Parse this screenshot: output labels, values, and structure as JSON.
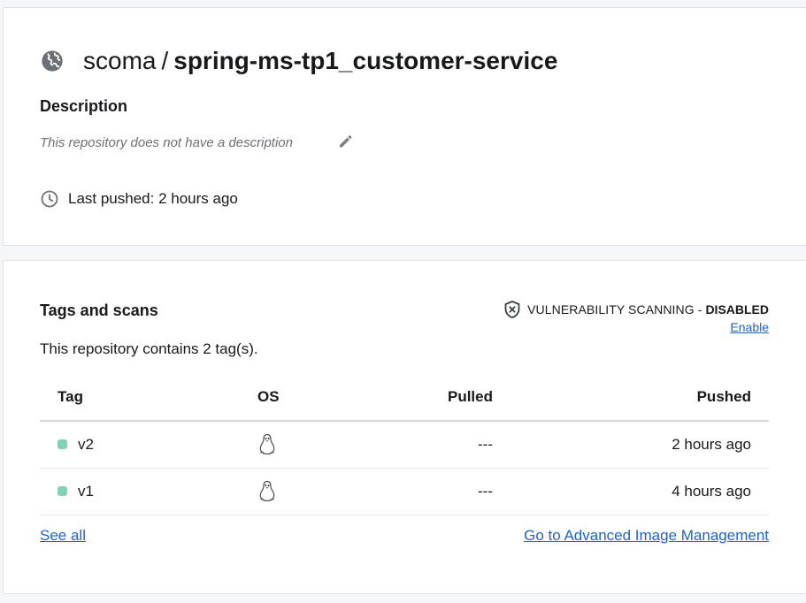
{
  "repo": {
    "namespace": "scoma",
    "separator": "/",
    "name": "spring-ms-tp1_customer-service",
    "description_heading": "Description",
    "description_text": "This repository does not have a description",
    "last_pushed": "Last pushed: 2 hours ago",
    "icons": {
      "globe": "globe-icon",
      "edit": "pencil-icon",
      "clock": "clock-icon"
    }
  },
  "tags": {
    "heading": "Tags and scans",
    "vuln_label": "VULNERABILITY SCANNING",
    "vuln_dash": "-",
    "vuln_status": "DISABLED",
    "enable_link": "Enable",
    "contains_text": "This repository contains 2 tag(s).",
    "columns": {
      "tag": "Tag",
      "os": "OS",
      "pulled": "Pulled",
      "pushed": "Pushed"
    },
    "rows": [
      {
        "tag": "v2",
        "os_icon": "linux-icon",
        "pulled": "---",
        "pushed": "2 hours ago"
      },
      {
        "tag": "v1",
        "os_icon": "linux-icon",
        "pulled": "---",
        "pushed": "4 hours ago"
      }
    ],
    "see_all": "See all",
    "advanced_link": "Go to Advanced Image Management",
    "colors": {
      "link": "#1d63c9",
      "tag_dot": "#7ed3b6"
    }
  }
}
